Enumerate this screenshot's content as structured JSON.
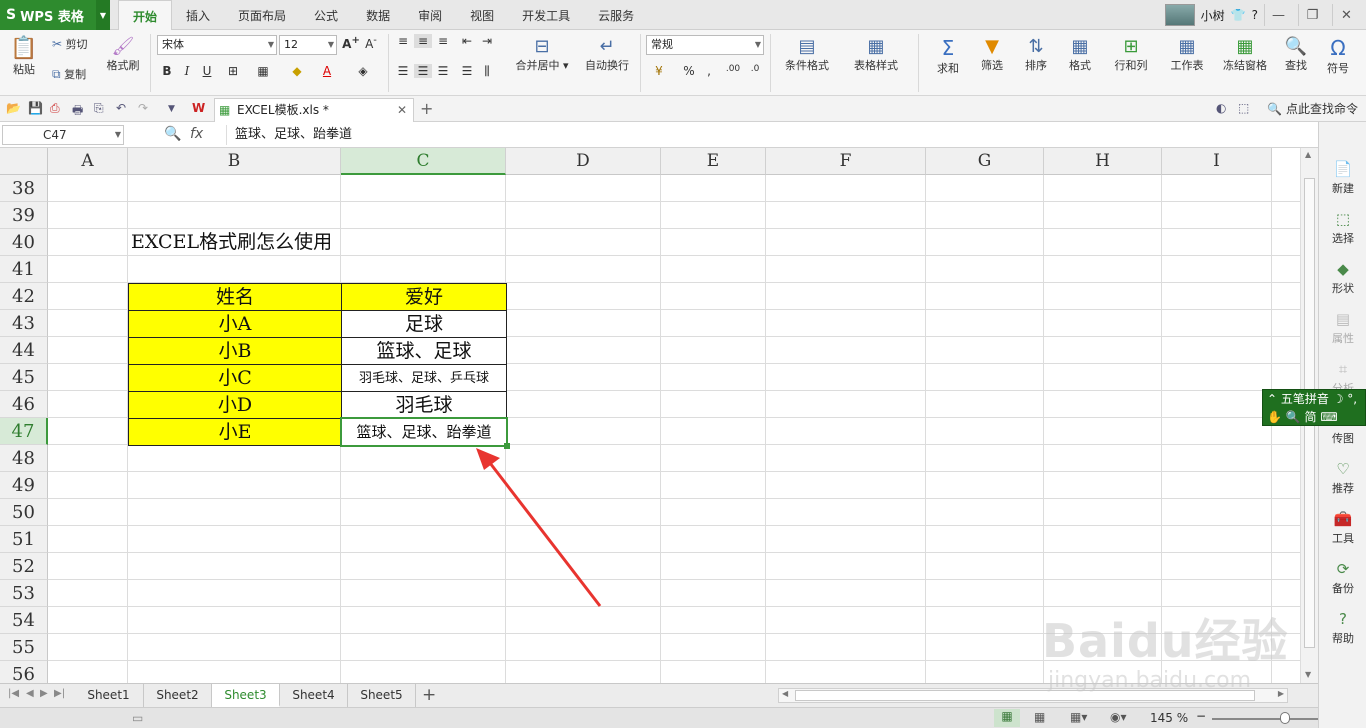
{
  "app": {
    "logo": "WPS 表格"
  },
  "menu_tabs": [
    "开始",
    "插入",
    "页面布局",
    "公式",
    "数据",
    "审阅",
    "视图",
    "开发工具",
    "云服务"
  ],
  "user": {
    "name": "小树"
  },
  "ribbon": {
    "paste": "粘贴",
    "cut": "剪切",
    "copy": "复制",
    "format_painter": "格式刷",
    "font_name": "宋体",
    "font_size": "12",
    "merge_center": "合并居中",
    "wrap_text": "自动换行",
    "number_format": "常规",
    "conditional_format": "条件格式",
    "table_style": "表格样式",
    "sum": "求和",
    "filter": "筛选",
    "sort": "排序",
    "format": "格式",
    "rows_cols": "行和列",
    "worksheet": "工作表",
    "freeze": "冻结窗格",
    "find": "查找",
    "symbol": "符号"
  },
  "document": {
    "tab_title": "EXCEL模板.xls *",
    "search_cmd": "点此查找命令"
  },
  "formula_bar": {
    "name_box": "C47",
    "content": "篮球、足球、跆拳道"
  },
  "columns": [
    "A",
    "B",
    "C",
    "D",
    "E",
    "F",
    "G",
    "H",
    "I"
  ],
  "rows": [
    "38",
    "39",
    "40",
    "41",
    "42",
    "43",
    "44",
    "45",
    "46",
    "47",
    "48",
    "49",
    "50",
    "51",
    "52",
    "53",
    "54",
    "55",
    "56"
  ],
  "sheet": {
    "title": "EXCEL格式刷怎么使用",
    "header": {
      "name": "姓名",
      "hobby": "爱好"
    },
    "records": [
      {
        "name": "小A",
        "hobby": "足球"
      },
      {
        "name": "小B",
        "hobby": "篮球、足球"
      },
      {
        "name": "小C",
        "hobby": "羽毛球、足球、乒乓球"
      },
      {
        "name": "小D",
        "hobby": "羽毛球"
      },
      {
        "name": "小E",
        "hobby": "篮球、足球、跆拳道"
      }
    ]
  },
  "sheet_tabs": [
    "Sheet1",
    "Sheet2",
    "Sheet3",
    "Sheet4",
    "Sheet5"
  ],
  "active_sheet": "Sheet3",
  "status": {
    "zoom": "145 %"
  },
  "sidebar": [
    "新建",
    "选择",
    "形状",
    "属性",
    "分析",
    "传图",
    "推荐",
    "工具",
    "备份",
    "帮助"
  ],
  "ime": {
    "line1": "五笔拼音",
    "line2": "简"
  },
  "watermark": {
    "brand": "Baidu经验",
    "url": "jingyan.baidu.com"
  },
  "colors": {
    "accent": "#2e8b2e",
    "header_fill": "#ffff00",
    "selection": "#3c9a3c",
    "arrow": "#e8342f"
  }
}
